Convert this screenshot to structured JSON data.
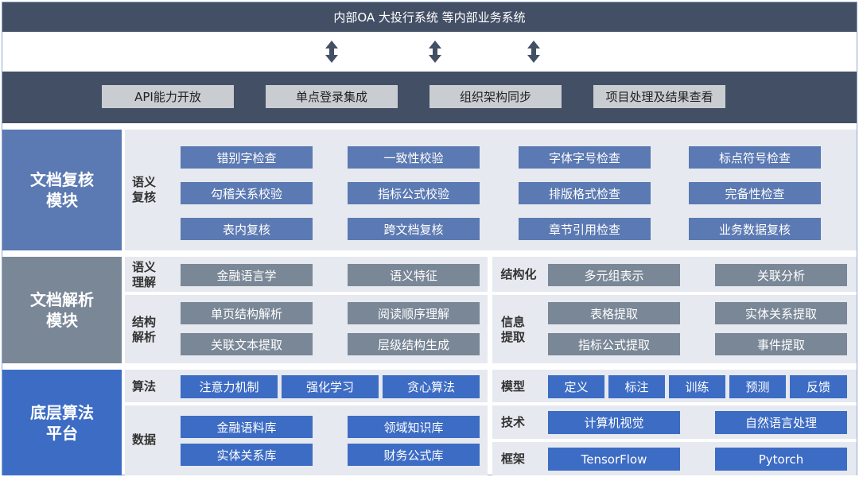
{
  "top_bar": {
    "title": "内部OA 大投行系统 等内部业务系统"
  },
  "platform": {
    "buttons": [
      "API能力开放",
      "单点登录集成",
      "组织架构同步",
      "项目处理及结果查看"
    ]
  },
  "review_module": {
    "title": "文档复核\n模块",
    "sublabel": "语义\n复核",
    "rows": [
      [
        "错别字检查",
        "一致性校验",
        "字体字号检查",
        "标点符号检查"
      ],
      [
        "勾稽关系校验",
        "指标公式校验",
        "排版格式检查",
        "完备性检查"
      ],
      [
        "表内复核",
        "跨文档复核",
        "章节引用检查",
        "业务数据复核"
      ]
    ]
  },
  "parse_module": {
    "title": "文档解析\n模块",
    "semantic_label": "语义\n理解",
    "semantic_items": [
      "金融语言学",
      "语义特征"
    ],
    "struct_label": "结构\n解析",
    "struct_items": [
      [
        "单页结构解析",
        "阅读顺序理解"
      ],
      [
        "关联文本提取",
        "层级结构生成"
      ]
    ],
    "structuring_label": "结构化",
    "structuring_items": [
      "多元组表示",
      "关联分析"
    ],
    "info_label": "信息\n提取",
    "info_items": [
      [
        "表格提取",
        "实体关系提取"
      ],
      [
        "指标公式提取",
        "事件提取"
      ]
    ]
  },
  "algo_module": {
    "title": "底层算法\n平台",
    "algo_label": "算法",
    "algo_items": [
      "注意力机制",
      "强化学习",
      "贪心算法"
    ],
    "data_label": "数据",
    "data_items": [
      [
        "金融语料库",
        "领域知识库"
      ],
      [
        "实体关系库",
        "财务公式库"
      ]
    ],
    "model_label": "模型",
    "model_items": [
      "定义",
      "标注",
      "训练",
      "预测",
      "反馈"
    ],
    "tech_label": "技术",
    "tech_items": [
      "计算机视觉",
      "自然语言处理"
    ],
    "framework_label": "框架",
    "framework_items": [
      "TensorFlow",
      "Pytorch"
    ]
  },
  "colors": {
    "dark_bar": "#434f65",
    "review_blue": "#5b79b2",
    "parse_gray": "#7a8797",
    "algo_blue": "#3d6cc4",
    "panel_bg": "#e6e9ef"
  }
}
